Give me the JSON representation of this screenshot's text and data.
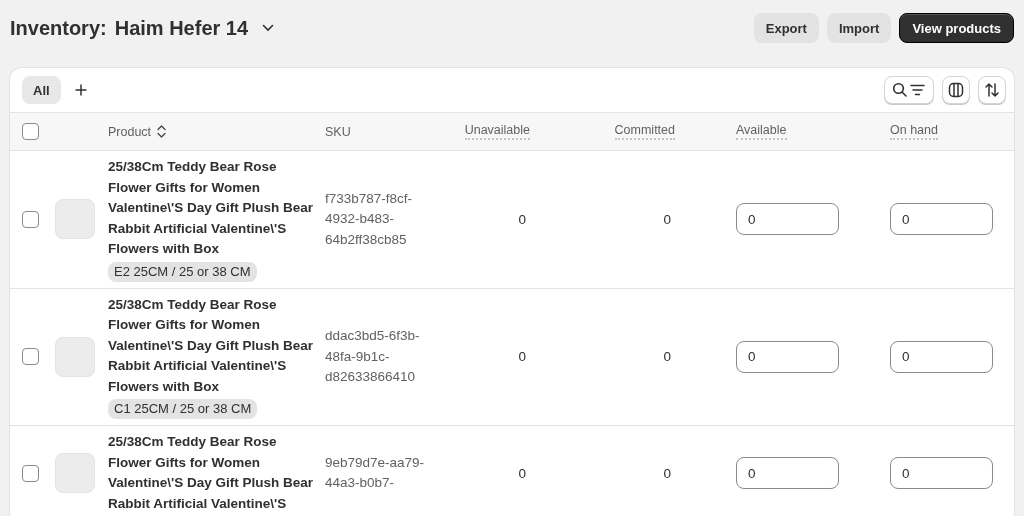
{
  "header": {
    "title": "Inventory:",
    "location": "Haim Hefer 14"
  },
  "actions": [
    {
      "label": "Export",
      "kind": "secondary"
    },
    {
      "label": "Import",
      "kind": "secondary"
    },
    {
      "label": "View products",
      "kind": "primary"
    }
  ],
  "tabs": [
    {
      "label": "All",
      "selected": true
    }
  ],
  "table": {
    "all_checked": false,
    "columns": [
      {
        "label": "Product",
        "kind": "sort"
      },
      {
        "label": "SKU",
        "kind": "plain"
      },
      {
        "label": "Unavailable",
        "kind": "hint"
      },
      {
        "label": "Committed",
        "kind": "hint"
      },
      {
        "label": "Available",
        "kind": "hint"
      },
      {
        "label": "On hand",
        "kind": "hint"
      }
    ],
    "rows": [
      {
        "checked": false,
        "name": "25/38Cm Teddy Bear Rose Flower Gifts for Women Valentine\\'S Day Gift Plush Bear Rabbit Artificial Valentine\\'S Flowers with Box",
        "variant": "E2 25CM / 25 or 38 CM",
        "sku": "f733b787-f8cf-4932-b483-64b2ff38cb85",
        "unavailable": "0",
        "committed": "0",
        "available": "0",
        "on_hand": "0"
      },
      {
        "checked": false,
        "name": "25/38Cm Teddy Bear Rose Flower Gifts for Women Valentine\\'S Day Gift Plush Bear Rabbit Artificial Valentine\\'S Flowers with Box",
        "variant": "C1 25CM / 25 or 38 CM",
        "sku": "ddac3bd5-6f3b-48fa-9b1c-d82633866410",
        "unavailable": "0",
        "committed": "0",
        "available": "0",
        "on_hand": "0"
      },
      {
        "checked": false,
        "name": "25/38Cm Teddy Bear Rose Flower Gifts for Women Valentine\\'S Day Gift Plush Bear Rabbit Artificial Valentine\\'S",
        "sku": "9eb79d7e-aa79-44a3-b0b7-",
        "unavailable": "0",
        "committed": "0",
        "available": "0",
        "on_hand": "0"
      }
    ]
  }
}
